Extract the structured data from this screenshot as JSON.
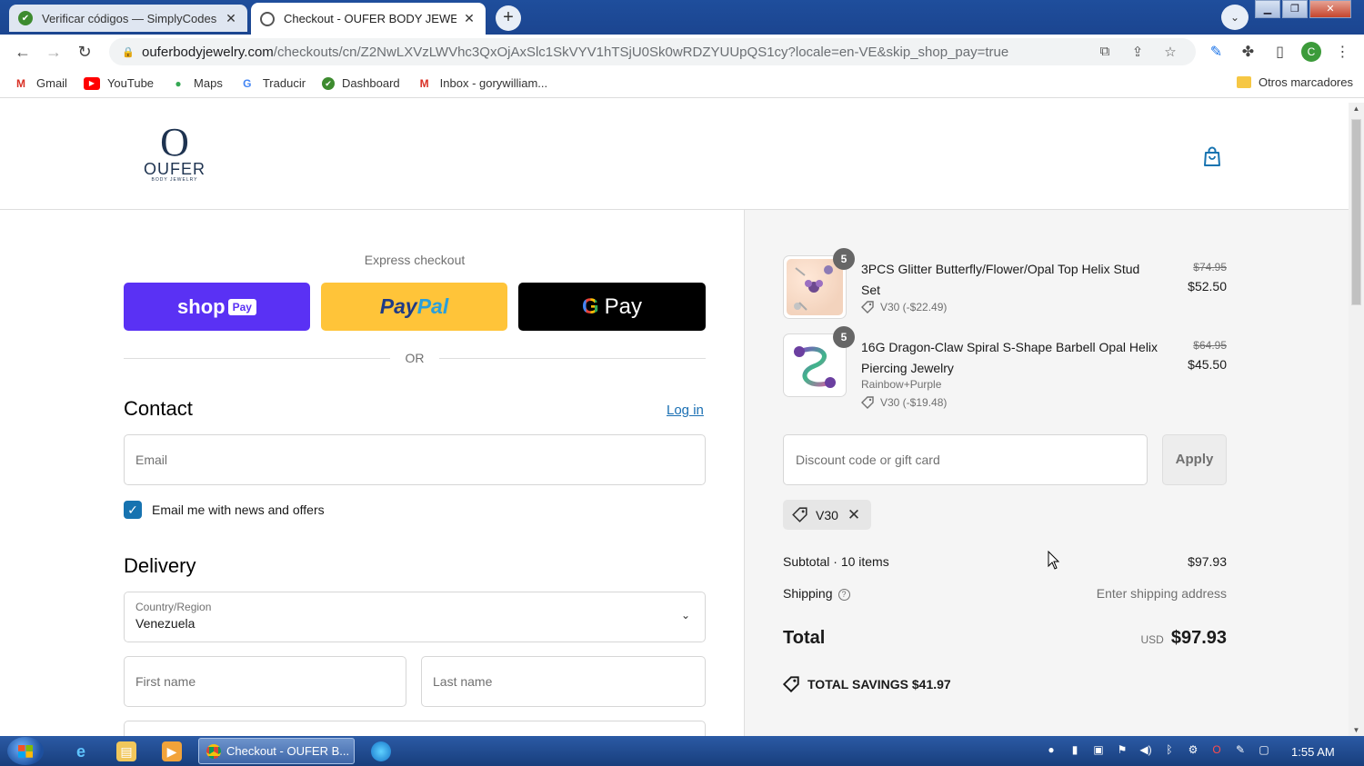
{
  "browser": {
    "tabs": [
      {
        "title": "Verificar códigos — SimplyCodes",
        "active": false
      },
      {
        "title": "Checkout - OUFER BODY JEWELRY",
        "active": true
      }
    ],
    "url_host": "ouferbodyjewelry.com",
    "url_path": "/checkouts/cn/Z2NwLXVzLWVhc3QxOjAxSlc1SkVYV1hTSjU0Sk0wRDZYUUpQS1cy?locale=en-VE&skip_shop_pay=true",
    "bookmarks": [
      "Gmail",
      "YouTube",
      "Maps",
      "Traducir",
      "Dashboard",
      "Inbox - gorywilliam..."
    ],
    "other_bookmarks": "Otros marcadores",
    "profile_initial": "C"
  },
  "store": {
    "logo_word": "OUFER",
    "logo_sub": "BODY JEWELRY"
  },
  "checkout": {
    "express_label": "Express checkout",
    "shoppay_label": "shop",
    "shoppay_tag": "Pay",
    "paypal_part1": "Pay",
    "paypal_part2": "Pal",
    "gpay_g": "G",
    "gpay_label": "Pay",
    "or_label": "OR",
    "contact_title": "Contact",
    "login_label": "Log in",
    "email_placeholder": "Email",
    "newsletter_label": "Email me with news and offers",
    "delivery_title": "Delivery",
    "country_label": "Country/Region",
    "country_value": "Venezuela",
    "first_name_placeholder": "First name",
    "last_name_placeholder": "Last name"
  },
  "summary": {
    "items": [
      {
        "name": "3PCS Glitter Butterfly/Flower/Opal Top Helix Stud Set",
        "quantity": "5",
        "variant": "",
        "discount": "V30 (-$22.49)",
        "original_price": "$74.95",
        "price": "$52.50"
      },
      {
        "name": "16G Dragon-Claw Spiral S-Shape Barbell Opal Helix Piercing Jewelry",
        "quantity": "5",
        "variant": "Rainbow+Purple",
        "discount": "V30 (-$19.48)",
        "original_price": "$64.95",
        "price": "$45.50"
      }
    ],
    "discount_placeholder": "Discount code or gift card",
    "apply_label": "Apply",
    "applied_code": "V30",
    "subtotal_label": "Subtotal · 10 items",
    "subtotal_value": "$97.93",
    "shipping_label": "Shipping",
    "shipping_value": "Enter shipping address",
    "total_label": "Total",
    "total_currency": "USD",
    "total_value": "$97.93",
    "savings_label": "TOTAL SAVINGS",
    "savings_value": "$41.97"
  },
  "taskbar": {
    "active_task": "Checkout - OUFER B...",
    "clock": "1:55 AM"
  },
  "colors": {
    "shoppay": "#5a31f4",
    "paypal": "#ffc439",
    "gpay": "#000000",
    "link": "#1a6fb3",
    "checkbox": "#1773b0",
    "summary_bg": "#f5f5f5"
  }
}
